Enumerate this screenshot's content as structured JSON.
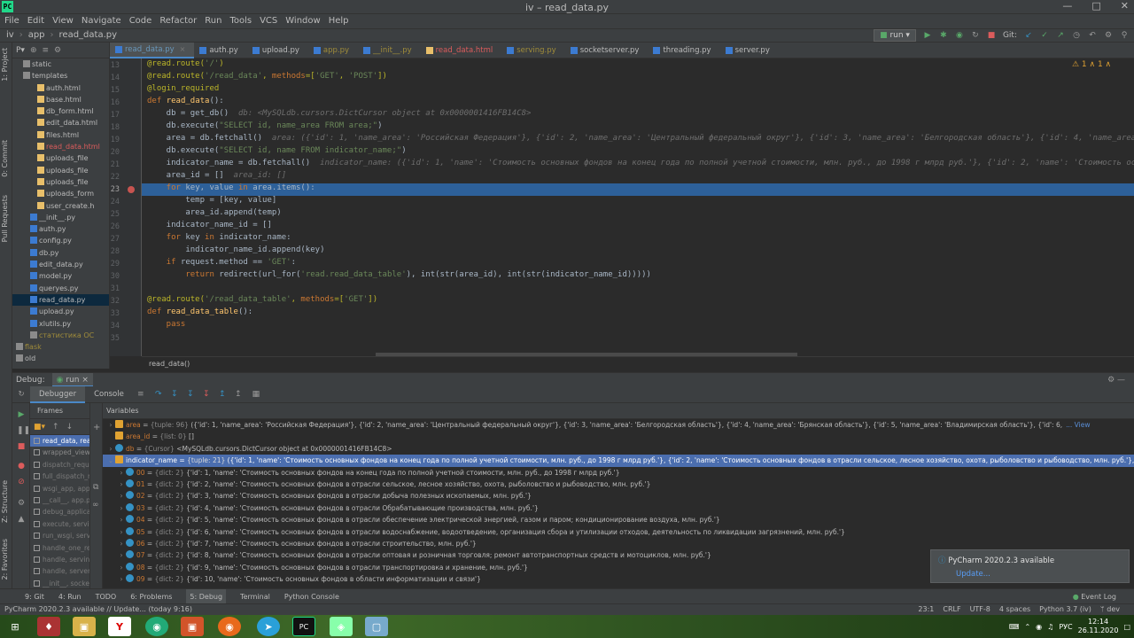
{
  "window": {
    "title": "iv – read_data.py",
    "logo": "PC"
  },
  "menu": [
    "File",
    "Edit",
    "View",
    "Navigate",
    "Code",
    "Refactor",
    "Run",
    "Tools",
    "VCS",
    "Window",
    "Help"
  ],
  "breadcrumbs": [
    "iv",
    "app",
    "read_data.py"
  ],
  "toolbar": {
    "run_config": "run",
    "git_label": "Git:"
  },
  "project": {
    "header": "P▾",
    "items": [
      {
        "label": "static",
        "indent": 2,
        "type": "folder"
      },
      {
        "label": "templates",
        "indent": 2,
        "type": "folder"
      },
      {
        "label": "auth.html",
        "indent": 4,
        "type": "html"
      },
      {
        "label": "base.html",
        "indent": 4,
        "type": "html"
      },
      {
        "label": "db_form.html",
        "indent": 4,
        "type": "html"
      },
      {
        "label": "edit_data.html",
        "indent": 4,
        "type": "html"
      },
      {
        "label": "files.html",
        "indent": 4,
        "type": "html"
      },
      {
        "label": "read_data.html",
        "indent": 4,
        "type": "html",
        "color": "red"
      },
      {
        "label": "uploads_file",
        "indent": 4,
        "type": "html"
      },
      {
        "label": "uploads_file",
        "indent": 4,
        "type": "html"
      },
      {
        "label": "uploads_file",
        "indent": 4,
        "type": "html"
      },
      {
        "label": "uploads_form",
        "indent": 4,
        "type": "html"
      },
      {
        "label": "user_create.h",
        "indent": 4,
        "type": "html"
      },
      {
        "label": "__init__.py",
        "indent": 3,
        "type": "py"
      },
      {
        "label": "auth.py",
        "indent": 3,
        "type": "py"
      },
      {
        "label": "config.py",
        "indent": 3,
        "type": "py"
      },
      {
        "label": "db.py",
        "indent": 3,
        "type": "py"
      },
      {
        "label": "edit_data.py",
        "indent": 3,
        "type": "py"
      },
      {
        "label": "model.py",
        "indent": 3,
        "type": "py"
      },
      {
        "label": "queryes.py",
        "indent": 3,
        "type": "py"
      },
      {
        "label": "read_data.py",
        "indent": 3,
        "type": "py",
        "selected": true
      },
      {
        "label": "upload.py",
        "indent": 3,
        "type": "py"
      },
      {
        "label": "xlutils.py",
        "indent": 3,
        "type": "py"
      },
      {
        "label": "статистика ОС",
        "indent": 3,
        "type": "folder",
        "color": "olive"
      },
      {
        "label": "flask",
        "indent": 1,
        "type": "folder",
        "color": "olive"
      },
      {
        "label": "old",
        "indent": 1,
        "type": "folder"
      }
    ]
  },
  "tabs": [
    {
      "label": "read_data.py",
      "active": true
    },
    {
      "label": "auth.py"
    },
    {
      "label": "upload.py"
    },
    {
      "label": "app.py",
      "color": "olive"
    },
    {
      "label": "__init__.py",
      "color": "olive"
    },
    {
      "label": "read_data.html",
      "color": "red"
    },
    {
      "label": "serving.py",
      "color": "olive"
    },
    {
      "label": "socketserver.py"
    },
    {
      "label": "threading.py"
    },
    {
      "label": "server.py"
    }
  ],
  "editor": {
    "first_line": 13,
    "current_line": 23,
    "breakpoint_line": 23,
    "inspection": "⚠ 1  ∧ 1  ∧",
    "crumb": "read_data()"
  },
  "debug": {
    "label": "Debug:",
    "run_tab": "run",
    "tabs": [
      "Debugger",
      "Console"
    ],
    "frames_header": "Frames",
    "variables_header": "Variables",
    "frames": [
      {
        "label": "read_data, rea",
        "selected": true
      },
      {
        "label": "wrapped_view"
      },
      {
        "label": "dispatch_reque",
        "lib": true
      },
      {
        "label": "full_dispatch_r",
        "lib": true
      },
      {
        "label": "wsgi_app, app.",
        "lib": true
      },
      {
        "label": "__call__, app.p",
        "lib": true
      },
      {
        "label": "debug_applica",
        "lib": true
      },
      {
        "label": "execute, servin",
        "lib": true
      },
      {
        "label": "run_wsgi, servi",
        "lib": true
      },
      {
        "label": "handle_one_re",
        "lib": true
      },
      {
        "label": "handle, serving",
        "lib": true
      },
      {
        "label": "handle, server",
        "lib": true
      },
      {
        "label": "__init__, socke",
        "lib": true
      }
    ],
    "variables": [
      {
        "depth": 0,
        "arrow": "›",
        "name": "area",
        "type": "{tuple: 96}",
        "value": "({'id': 1, 'name_area': 'Российская Федерация'}, {'id': 2, 'name_area': 'Центральный федеральный округ'}, {'id': 3, 'name_area': 'Белгородская область'}, {'id': 4, 'name_area': 'Брянская область'}, {'id': 5, 'name_area': 'Владимирская область'}, {'id': 6,",
        "view": "... View"
      },
      {
        "depth": 0,
        "arrow": "",
        "name": "area_id",
        "type": "{list: 0}",
        "value": "[]"
      },
      {
        "depth": 0,
        "arrow": "›",
        "name": "db",
        "type": "{Cursor}",
        "value": "<MySQLdb.cursors.DictCursor object at 0x0000001416FB14C8>"
      },
      {
        "depth": 0,
        "arrow": "⌄",
        "name": "indicator_name",
        "type": "{tuple: 21}",
        "value": "({'id': 1, 'name': 'Стоимость основных фондов на конец года по полной учетной стоимости, млн. руб., до 1998 г млрд руб.'}, {'id': 2, 'name': 'Стоимость основных фондов в отрасли сельское, лесное хозяйство, охота, рыболовство и рыбоводство, млн. руб.'}, {'i...",
        "view": "View",
        "selected": true
      },
      {
        "depth": 1,
        "arrow": "›",
        "name": "00",
        "type": "{dict: 2}",
        "value": "{'id': 1, 'name': 'Стоимость основных фондов на конец года по полной учетной стоимости, млн. руб., до 1998 г млрд руб.'}"
      },
      {
        "depth": 1,
        "arrow": "›",
        "name": "01",
        "type": "{dict: 2}",
        "value": "{'id': 2, 'name': 'Стоимость основных фондов в отрасли сельское, лесное хозяйство, охота, рыболовство и рыбоводство, млн. руб.'}"
      },
      {
        "depth": 1,
        "arrow": "›",
        "name": "02",
        "type": "{dict: 2}",
        "value": "{'id': 3, 'name': 'Стоимость основных фондов в отрасли добыча полезных ископаемых, млн. руб.'}"
      },
      {
        "depth": 1,
        "arrow": "›",
        "name": "03",
        "type": "{dict: 2}",
        "value": "{'id': 4, 'name': 'Стоимость основных фондов в отрасли Обрабатывающие производства, млн. руб.'}"
      },
      {
        "depth": 1,
        "arrow": "›",
        "name": "04",
        "type": "{dict: 2}",
        "value": "{'id': 5, 'name': 'Стоимость основных фондов в отрасли обеспечение электрической энергией, газом и паром; кондиционирование воздуха, млн. руб.'}"
      },
      {
        "depth": 1,
        "arrow": "›",
        "name": "05",
        "type": "{dict: 2}",
        "value": "{'id': 6, 'name': 'Стоимость основных фондов в отрасли водоснабжение, водоотведение, организация сбора и утилизации отходов, деятельность по ликвидации загрязнений, млн. руб.'}"
      },
      {
        "depth": 1,
        "arrow": "›",
        "name": "06",
        "type": "{dict: 2}",
        "value": "{'id': 7, 'name': 'Стоимость основных фондов в отрасли строительство, млн. руб.'}"
      },
      {
        "depth": 1,
        "arrow": "›",
        "name": "07",
        "type": "{dict: 2}",
        "value": "{'id': 8, 'name': 'Стоимость основных фондов в отрасли оптовая и розничная торговля; ремонт автотранспортных средств и мотоциклов, млн. руб.'}"
      },
      {
        "depth": 1,
        "arrow": "›",
        "name": "08",
        "type": "{dict: 2}",
        "value": "{'id': 9, 'name': 'Стоимость основных фондов в отрасли транспортировка и хранение, млн. руб.'}"
      },
      {
        "depth": 1,
        "arrow": "›",
        "name": "09",
        "type": "{dict: 2}",
        "value": "{'id': 10, 'name': 'Стоимость основных фондов в области информатизации и связи'}"
      }
    ]
  },
  "notification": {
    "title": "PyCharm 2020.2.3 available",
    "action": "Update..."
  },
  "bottom_tabs": [
    "9: Git",
    "4: Run",
    "TODO",
    "6: Problems",
    "5: Debug",
    "Terminal",
    "Python Console"
  ],
  "event_log": "Event Log",
  "status": {
    "message": "PyCharm 2020.2.3 available // Update... (today 9:16)",
    "position": "23:1",
    "line_sep": "CRLF",
    "encoding": "UTF-8",
    "indent": "4 spaces",
    "interpreter": "Python 3.7 (iv)",
    "branch": "ᛘ dev"
  },
  "taskbar": {
    "lang": "РУС",
    "time": "12:14",
    "date": "26.11.2020"
  },
  "colors": {
    "accent": "#2d6099",
    "selection": "#4b6eaf",
    "breakpoint": "#c75450"
  }
}
